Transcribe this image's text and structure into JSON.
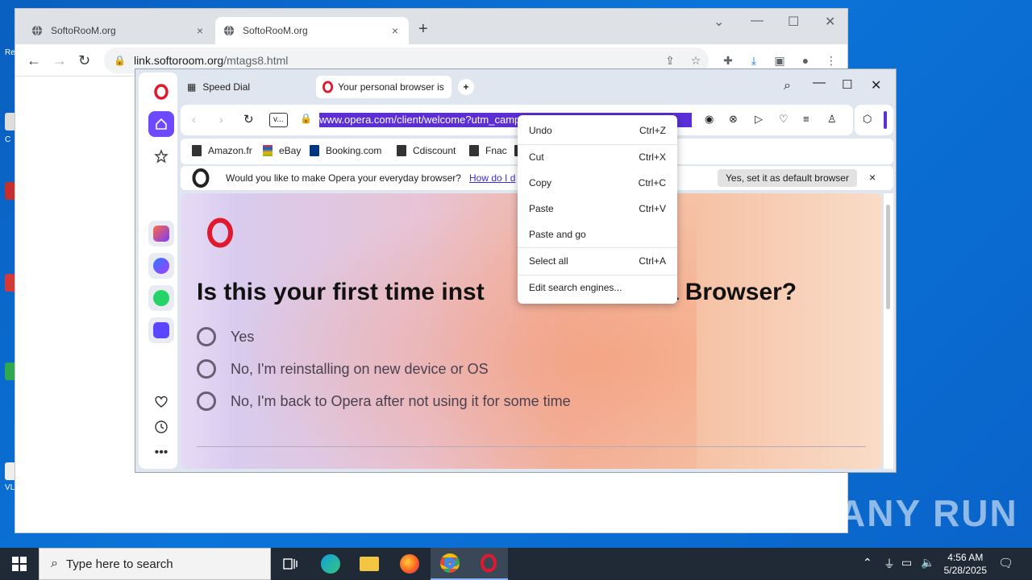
{
  "chrome": {
    "tabs": [
      {
        "title": "SoftoRooM.org"
      },
      {
        "title": "SoftoRooM.org"
      }
    ],
    "new_tab": "+",
    "url_host": "link.softoroom.org",
    "url_path": "/mtags8.html"
  },
  "opera": {
    "tabs": [
      {
        "title": "Speed Dial"
      },
      {
        "title": "Your personal browser is a"
      }
    ],
    "address_badge": "v...",
    "url": "www.opera.com/client/welcome?utm_campaign=...&utm",
    "bookmarks": [
      "Amazon.fr",
      "eBay",
      "Booking.com",
      "Cdiscount",
      "Fnac"
    ],
    "infobar": {
      "question": "Would you like to make Opera your everyday browser?",
      "link": "How do I d",
      "button": "Yes, set it as default browser",
      "close": "×"
    },
    "page": {
      "headline_left": "Is this your first time inst",
      "headline_right": "a Browser?",
      "options": [
        "Yes",
        "No, I'm reinstalling on new device or OS",
        "No, I'm back to Opera after not using it for some time"
      ]
    }
  },
  "context_menu": {
    "items": [
      {
        "label": "Undo",
        "shortcut": "Ctrl+Z"
      },
      {
        "label": "Cut",
        "shortcut": "Ctrl+X"
      },
      {
        "label": "Copy",
        "shortcut": "Ctrl+C"
      },
      {
        "label": "Paste",
        "shortcut": "Ctrl+V"
      },
      {
        "label": "Paste and go",
        "shortcut": ""
      },
      {
        "label": "Select all",
        "shortcut": "Ctrl+A"
      },
      {
        "label": "Edit search engines...",
        "shortcut": ""
      }
    ]
  },
  "taskbar": {
    "search_placeholder": "Type here to search",
    "time": "4:56 AM",
    "date": "5/28/2025"
  },
  "desktop": {
    "labels": [
      "Re",
      "C",
      "VL"
    ]
  },
  "watermark": "ANY RUN",
  "colors": {
    "opera_red": "#e0192e",
    "selection": "#5b2fd6",
    "opera_accent": "#6d4aff",
    "desktop_blue": "#0b74d9"
  }
}
